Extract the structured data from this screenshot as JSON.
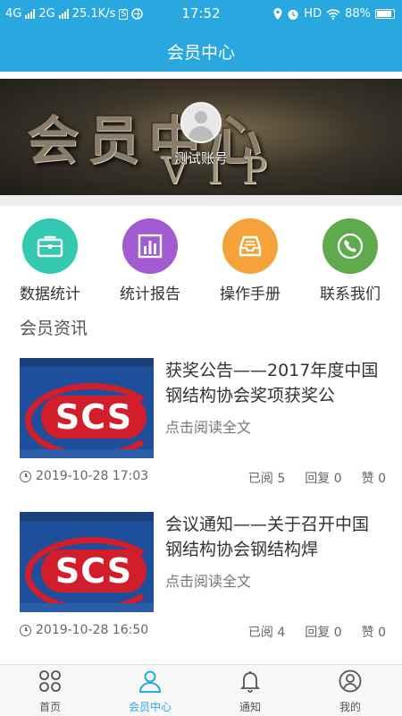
{
  "status_bar": {
    "net1": "4G",
    "net2": "2G",
    "speed": "25.1K/s",
    "s_badge": "S",
    "time": "17:52",
    "hd": "HD",
    "battery": "88%"
  },
  "header": {
    "title": "会员中心"
  },
  "banner": {
    "title_art": "会员中心",
    "vip_art": "VIP",
    "username": "测试账号"
  },
  "quick_menu": [
    {
      "label": "数据统计",
      "icon": "briefcase-icon",
      "color": "#33c9b0"
    },
    {
      "label": "统计报告",
      "icon": "bar-chart-icon",
      "color": "#a25bd1"
    },
    {
      "label": "操作手册",
      "icon": "inbox-icon",
      "color": "#f5a23a"
    },
    {
      "label": "联系我们",
      "icon": "phone-icon",
      "color": "#5eaa4c"
    }
  ],
  "section_title": "会员资讯",
  "news": [
    {
      "title": "获奖公告——2017年度中国钢结构协会奖项获奖公",
      "read_more": "点击阅读全文",
      "thumb_logo": "SCS",
      "time": "2019-10-28 17:03",
      "views": "已阅 5",
      "replies": "回复 0",
      "likes": "赞 0"
    },
    {
      "title": "会议通知——关于召开中国钢结构协会钢结构焊",
      "read_more": "点击阅读全文",
      "thumb_logo": "SCS",
      "time": "2019-10-28 16:50",
      "views": "已阅 4",
      "replies": "回复 0",
      "likes": "赞 0"
    }
  ],
  "bottom_nav": [
    {
      "label": "首页",
      "icon": "home-grid-icon"
    },
    {
      "label": "会员中心",
      "icon": "user-icon",
      "active": true
    },
    {
      "label": "通知",
      "icon": "bell-icon"
    },
    {
      "label": "我的",
      "icon": "profile-circle-icon"
    }
  ],
  "colors": {
    "primary": "#29a8e0",
    "active_nav": "#29a8e0"
  }
}
